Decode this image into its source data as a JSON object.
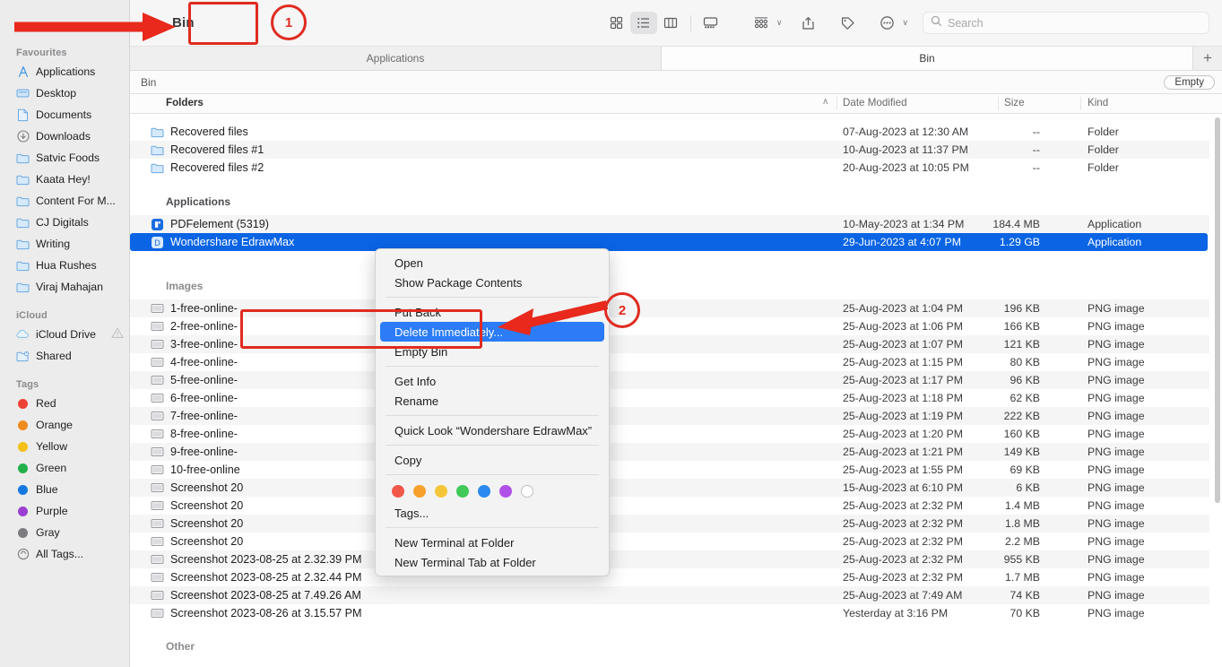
{
  "window": {
    "title": "Bin",
    "breadcrumb_chevron": "›"
  },
  "toolbar": {
    "view_icons": [
      {
        "name": "icon-view-button",
        "label": "Icon view"
      },
      {
        "name": "list-view-button",
        "label": "List view"
      },
      {
        "name": "column-view-button",
        "label": "Column view"
      },
      {
        "name": "gallery-view-button",
        "label": "Gallery view"
      }
    ],
    "group_by_label": "Group by",
    "share_label": "Share",
    "tags_label": "Tags",
    "more_label": "More",
    "chevron": "∨"
  },
  "search": {
    "placeholder": "Search",
    "value": "",
    "icon": "search-icon"
  },
  "tabs": [
    {
      "label": "Applications",
      "active": false
    },
    {
      "label": "Bin",
      "active": true
    }
  ],
  "new_tab_label": "+",
  "pathbar": {
    "label": "Bin",
    "empty_button": "Empty"
  },
  "columns": {
    "name": "Folders",
    "date": "Date Modified",
    "size": "Size",
    "kind": "Kind",
    "sort_arrow": "∧"
  },
  "groups": [
    {
      "label": "Applications"
    },
    {
      "label": "Images"
    },
    {
      "label": "Other"
    }
  ],
  "files": [
    {
      "name": "Recovered files",
      "date": "07-Aug-2023 at 12:30 AM",
      "size": "--",
      "kind": "Folder",
      "icon": "folder-icon",
      "selected": false
    },
    {
      "name": "Recovered files #1",
      "date": "10-Aug-2023 at 11:37 PM",
      "size": "--",
      "kind": "Folder",
      "icon": "folder-icon",
      "selected": false
    },
    {
      "name": "Recovered files #2",
      "date": "20-Aug-2023 at 10:05 PM",
      "size": "--",
      "kind": "Folder",
      "icon": "folder-icon",
      "selected": false
    },
    {
      "name": "PDFelement (5319)",
      "date": "10-May-2023 at 1:34 PM",
      "size": "184.4 MB",
      "kind": "Application",
      "icon": "pdfelement-app-icon",
      "selected": false
    },
    {
      "name": "Wondershare EdrawMax",
      "date": "29-Jun-2023 at 4:07 PM",
      "size": "1.29 GB",
      "kind": "Application",
      "icon": "edrawmax-app-icon",
      "selected": true
    },
    {
      "name": "1-free-online-",
      "date": "25-Aug-2023 at 1:04 PM",
      "size": "196 KB",
      "kind": "PNG image",
      "icon": "image-icon",
      "selected": false
    },
    {
      "name": "2-free-online-",
      "date": "25-Aug-2023 at 1:06 PM",
      "size": "166 KB",
      "kind": "PNG image",
      "icon": "image-icon",
      "selected": false
    },
    {
      "name": "3-free-online-",
      "date": "25-Aug-2023 at 1:07 PM",
      "size": "121 KB",
      "kind": "PNG image",
      "icon": "image-icon",
      "selected": false
    },
    {
      "name": "4-free-online-",
      "date": "25-Aug-2023 at 1:15 PM",
      "size": "80 KB",
      "kind": "PNG image",
      "icon": "image-icon",
      "selected": false
    },
    {
      "name": "5-free-online-",
      "date": "25-Aug-2023 at 1:17 PM",
      "size": "96 KB",
      "kind": "PNG image",
      "icon": "image-icon",
      "selected": false
    },
    {
      "name": "6-free-online-",
      "date": "25-Aug-2023 at 1:18 PM",
      "size": "62 KB",
      "kind": "PNG image",
      "icon": "image-icon",
      "selected": false
    },
    {
      "name": "7-free-online-",
      "date": "25-Aug-2023 at 1:19 PM",
      "size": "222 KB",
      "kind": "PNG image",
      "icon": "image-icon",
      "selected": false
    },
    {
      "name": "8-free-online-",
      "date": "25-Aug-2023 at 1:20 PM",
      "size": "160 KB",
      "kind": "PNG image",
      "icon": "image-icon",
      "selected": false
    },
    {
      "name": "9-free-online-",
      "date": "25-Aug-2023 at 1:21 PM",
      "size": "149 KB",
      "kind": "PNG image",
      "icon": "image-icon",
      "selected": false
    },
    {
      "name": "10-free-online",
      "date": "25-Aug-2023 at 1:55 PM",
      "size": "69 KB",
      "kind": "PNG image",
      "icon": "image-icon",
      "selected": false
    },
    {
      "name": "Screenshot 20",
      "date": "15-Aug-2023 at 6:10 PM",
      "size": "6 KB",
      "kind": "PNG image",
      "icon": "image-icon",
      "selected": false
    },
    {
      "name": "Screenshot 20",
      "date": "25-Aug-2023 at 2:32 PM",
      "size": "1.4 MB",
      "kind": "PNG image",
      "icon": "image-icon",
      "selected": false
    },
    {
      "name": "Screenshot 20",
      "date": "25-Aug-2023 at 2:32 PM",
      "size": "1.8 MB",
      "kind": "PNG image",
      "icon": "image-icon",
      "selected": false
    },
    {
      "name": "Screenshot 20",
      "date": "25-Aug-2023 at 2:32 PM",
      "size": "2.2 MB",
      "kind": "PNG image",
      "icon": "image-icon",
      "selected": false
    },
    {
      "name": "Screenshot 2023-08-25 at 2.32.39 PM",
      "date": "25-Aug-2023 at 2:32 PM",
      "size": "955 KB",
      "kind": "PNG image",
      "icon": "image-icon",
      "selected": false
    },
    {
      "name": "Screenshot 2023-08-25 at 2.32.44 PM",
      "date": "25-Aug-2023 at 2:32 PM",
      "size": "1.7 MB",
      "kind": "PNG image",
      "icon": "image-icon",
      "selected": false
    },
    {
      "name": "Screenshot 2023-08-25 at 7.49.26 AM",
      "date": "25-Aug-2023 at 7:49 AM",
      "size": "74 KB",
      "kind": "PNG image",
      "icon": "image-icon",
      "selected": false
    },
    {
      "name": "Screenshot 2023-08-26 at 3.15.57 PM",
      "date": "Yesterday at 3:16 PM",
      "size": "70 KB",
      "kind": "PNG image",
      "icon": "image-icon",
      "selected": false
    }
  ],
  "context_menu": {
    "items": [
      {
        "label": "Open",
        "selected": false
      },
      {
        "label": "Show Package Contents",
        "selected": false
      },
      {
        "label": "Put Back",
        "selected": false
      },
      {
        "label": "Delete Immediately...",
        "selected": true
      },
      {
        "label": "Empty Bin",
        "selected": false
      },
      {
        "label": "Get Info",
        "selected": false
      },
      {
        "label": "Rename",
        "selected": false
      },
      {
        "label": "Quick Look “Wondershare EdrawMax”",
        "selected": false
      },
      {
        "label": "Copy",
        "selected": false
      },
      {
        "label": "Tags...",
        "selected": false
      },
      {
        "label": "New Terminal at Folder",
        "selected": false
      },
      {
        "label": "New Terminal Tab at Folder",
        "selected": false
      }
    ],
    "tag_swatches": [
      "#f2584a",
      "#f7a02c",
      "#f5c63a",
      "#41c95a",
      "#2b89f0",
      "#b052e8",
      "none"
    ]
  },
  "sidebar": {
    "groups": [
      {
        "label": "Favourites",
        "items": [
          {
            "label": "Applications",
            "icon": "applications-icon"
          },
          {
            "label": "Desktop",
            "icon": "desktop-icon"
          },
          {
            "label": "Documents",
            "icon": "documents-icon"
          },
          {
            "label": "Downloads",
            "icon": "downloads-icon"
          },
          {
            "label": "Satvic Foods",
            "icon": "folder-icon"
          },
          {
            "label": "Kaata Hey!",
            "icon": "folder-icon"
          },
          {
            "label": "Content For M...",
            "icon": "folder-icon"
          },
          {
            "label": "CJ Digitals",
            "icon": "folder-icon"
          },
          {
            "label": "Writing",
            "icon": "folder-icon"
          },
          {
            "label": "Hua Rushes",
            "icon": "folder-icon"
          },
          {
            "label": "Viraj Mahajan",
            "icon": "folder-icon"
          }
        ]
      },
      {
        "label": "iCloud",
        "items": [
          {
            "label": "iCloud Drive",
            "icon": "icloud-icon",
            "warning": true
          },
          {
            "label": "Shared",
            "icon": "shared-folder-icon"
          }
        ]
      },
      {
        "label": "Tags",
        "items": [
          {
            "label": "Red",
            "icon": "tag-dot-icon",
            "color": "#ef4136"
          },
          {
            "label": "Orange",
            "icon": "tag-dot-icon",
            "color": "#ef8c1e"
          },
          {
            "label": "Yellow",
            "icon": "tag-dot-icon",
            "color": "#f2c019"
          },
          {
            "label": "Green",
            "icon": "tag-dot-icon",
            "color": "#23b04b"
          },
          {
            "label": "Blue",
            "icon": "tag-dot-icon",
            "color": "#1478e0"
          },
          {
            "label": "Purple",
            "icon": "tag-dot-icon",
            "color": "#9b3fd1"
          },
          {
            "label": "Gray",
            "icon": "tag-dot-icon",
            "color": "#7c7c80"
          },
          {
            "label": "All Tags...",
            "icon": "all-tags-icon"
          }
        ]
      }
    ]
  },
  "annotations": {
    "marker_1": "1",
    "marker_2": "2",
    "accent_color": "#e02b20"
  }
}
